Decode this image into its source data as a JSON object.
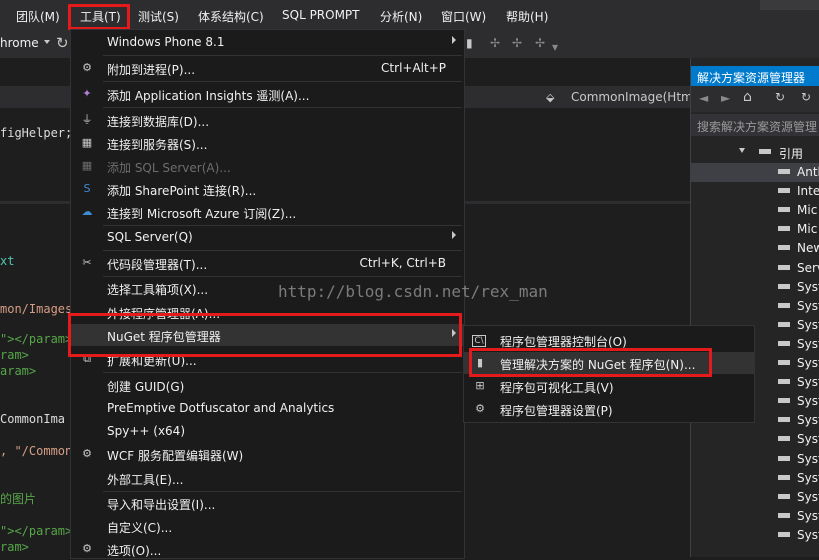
{
  "menubar": {
    "items": [
      "团队(M)",
      "工具(T)",
      "测试(S)",
      "体系结构(C)",
      "SQL PROMPT",
      "分析(N)",
      "窗口(W)",
      "帮助(H)"
    ]
  },
  "toolbar": {
    "browser_label": "hrome"
  },
  "editor": {
    "nav_dropdown": "CommonImage(Htm",
    "code_lines": [
      "figHelper;",
      "xt",
      "mon/Images",
      "\"></param>",
      "ram>",
      "aram>",
      " CommonIma",
      ", \"/Common",
      "的图片",
      "\"></param>",
      "ram>"
    ]
  },
  "solution_explorer": {
    "title": "解决方案资源管理器",
    "search_placeholder": "搜索解决方案资源管理",
    "references_label": "引用",
    "items": [
      "Antl",
      "Inte",
      "Mic",
      "Mic",
      "New",
      "Serv",
      "Syst",
      "Syst",
      "Syst",
      "Syst",
      "Syst",
      "Syst",
      "Syst",
      "Syst",
      "Syst",
      "Syst",
      "Syst",
      "Syst",
      "Syst",
      "Syst"
    ]
  },
  "tools_menu": {
    "items": [
      {
        "label": "Windows Phone 8.1",
        "shortcut": "",
        "submenu": true
      },
      {
        "label": "附加到进程(P)...",
        "shortcut": "Ctrl+Alt+P"
      },
      {
        "label": "添加 Application Insights 遥测(A)...",
        "shortcut": ""
      },
      {
        "label": "连接到数据库(D)...",
        "shortcut": ""
      },
      {
        "label": "连接到服务器(S)...",
        "shortcut": ""
      },
      {
        "label": "添加 SQL Server(A)...",
        "shortcut": "",
        "disabled": true
      },
      {
        "label": "添加 SharePoint 连接(R)...",
        "shortcut": ""
      },
      {
        "label": "连接到 Microsoft Azure 订阅(Z)...",
        "shortcut": ""
      },
      {
        "label": "SQL Server(Q)",
        "shortcut": "",
        "submenu": true
      },
      {
        "label": "代码段管理器(T)...",
        "shortcut": "Ctrl+K, Ctrl+B"
      },
      {
        "label": "选择工具箱项(X)...",
        "shortcut": ""
      },
      {
        "label": "外接程序管理器(A)...",
        "shortcut": ""
      },
      {
        "label": "NuGet 程序包管理器",
        "shortcut": "",
        "submenu": true
      },
      {
        "label": "扩展和更新(U)...",
        "shortcut": ""
      },
      {
        "label": "创建 GUID(G)",
        "shortcut": ""
      },
      {
        "label": "PreEmptive Dotfuscator and Analytics",
        "shortcut": ""
      },
      {
        "label": "Spy++ (x64)",
        "shortcut": ""
      },
      {
        "label": "WCF 服务配置编辑器(W)",
        "shortcut": ""
      },
      {
        "label": "外部工具(E)...",
        "shortcut": ""
      },
      {
        "label": "导入和导出设置(I)...",
        "shortcut": ""
      },
      {
        "label": "自定义(C)...",
        "shortcut": ""
      },
      {
        "label": "选项(O)...",
        "shortcut": ""
      }
    ]
  },
  "nuget_menu": {
    "items": [
      {
        "label": "程序包管理器控制台(O)"
      },
      {
        "label": "管理解决方案的 NuGet 程序包(N)..."
      },
      {
        "label": "程序包可视化工具(V)"
      },
      {
        "label": "程序包管理器设置(P)"
      }
    ]
  },
  "watermark": "http://blog.csdn.net/rex_man",
  "colors": {
    "highlight_box": "#e51a1a",
    "menu_bg": "#1b1b1c",
    "chrome_bg": "#2d2d30"
  }
}
